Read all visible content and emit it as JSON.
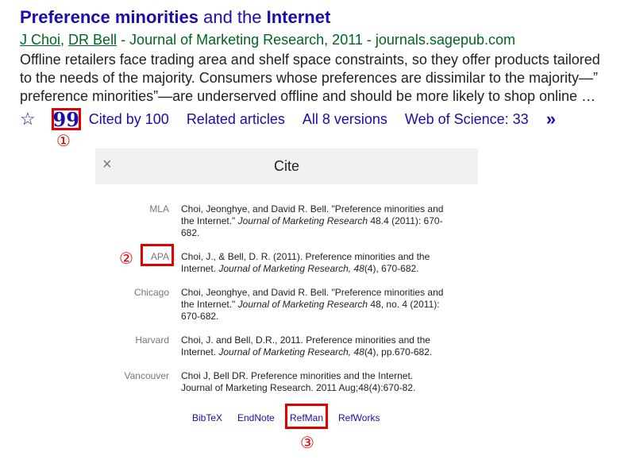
{
  "result": {
    "title_bold1": "Preference minorities",
    "title_mid": " and the ",
    "title_bold2": "Internet",
    "author1": "J Choi",
    "sep1": ", ",
    "author2": "DR Bell",
    "source": " - Journal of Marketing Research, 2011 - journals.sagepub.com",
    "snippet_line1": "Offline retailers face trading area and shelf space constraints, so they offer products tailored",
    "snippet_line2": "to the needs of the majority. Consumers whose preferences are dissimilar to the majority—”",
    "snippet_line3": "preference minorities”—are underserved offline and should be more likely to shop online …"
  },
  "actions": {
    "star_icon": "☆",
    "cite_icon": "99",
    "cited_by": "Cited by 100",
    "related": "Related articles",
    "versions": "All 8 versions",
    "wos": "Web of Science: 33",
    "more_icon": "»"
  },
  "markers": {
    "m1": "①",
    "m2": "②",
    "m3": "③"
  },
  "dialog": {
    "close_icon": "×",
    "title": "Cite",
    "citations": [
      {
        "style": "MLA",
        "line1": "Choi, Jeonghye, and David R. Bell. \"Preference minorities and",
        "line2a": "the Internet.\" ",
        "line2i": "Journal of Marketing Research",
        "line2b": " 48.4 (2011): 670-",
        "line3": "682."
      },
      {
        "style": "APA",
        "line1": "Choi, J., & Bell, D. R. (2011). Preference minorities and the",
        "line2a": "Internet. ",
        "line2i": "Journal of Marketing Research, 48",
        "line2b": "(4), 670-682.",
        "line3": ""
      },
      {
        "style": "Chicago",
        "line1": "Choi, Jeonghye, and David R. Bell. \"Preference minorities and",
        "line2a": "the Internet.\" ",
        "line2i": "Journal of Marketing Research",
        "line2b": " 48, no. 4 (2011):",
        "line3": "670-682."
      },
      {
        "style": "Harvard",
        "line1": "Choi, J. and Bell, D.R., 2011. Preference minorities and the",
        "line2a": "Internet. ",
        "line2i": "Journal of Marketing Research, 48",
        "line2b": "(4), pp.670-682.",
        "line3": ""
      },
      {
        "style": "Vancouver",
        "line1": "Choi J, Bell DR. Preference minorities and the Internet.",
        "line2a": "Journal of Marketing Research. 2011 Aug;48(4):670-82.",
        "line2i": "",
        "line2b": "",
        "line3": ""
      }
    ],
    "exports": [
      "BibTeX",
      "EndNote",
      "RefMan",
      "RefWorks"
    ]
  }
}
